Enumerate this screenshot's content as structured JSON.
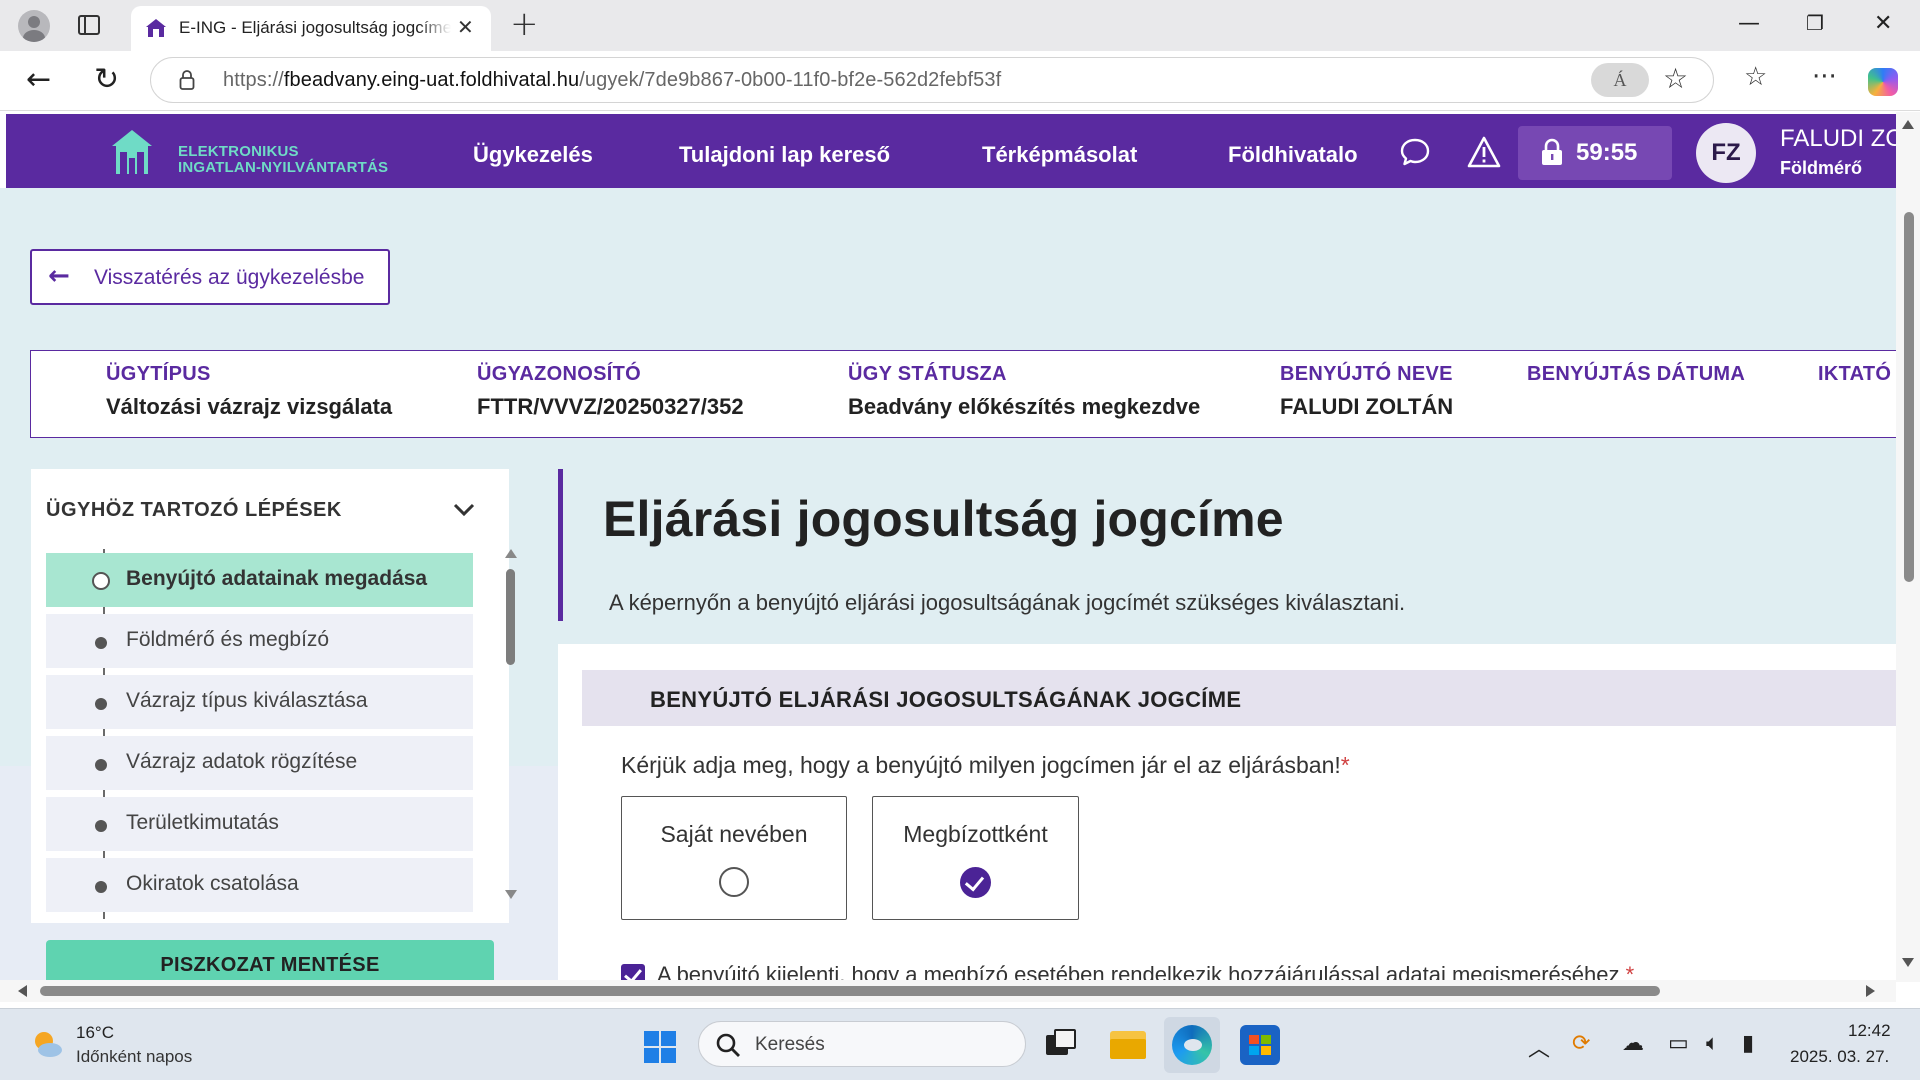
{
  "browser": {
    "tab_title": "E-ING - Eljárási jogosultság jogcíme",
    "url_prefix": "https://",
    "url_host": "fbeadvany.eing-uat.foldhivatal.hu",
    "url_path": "/ugyek/7de9b867-0b00-11f0-bf2e-562d2febf53f",
    "read_aloud": "Á"
  },
  "header": {
    "logo_line1": "ELEKTRONIKUS",
    "logo_line2": "INGATLAN-NYILVÁNTARTÁS",
    "nav": [
      "Ügykezelés",
      "Tulajdoni lap kereső",
      "Térképmásolat",
      "Földhivatalo"
    ],
    "timer": "59:55",
    "avatar_initials": "FZ",
    "user_name": "FALUDI ZO",
    "user_role": "Földmérő"
  },
  "back_button": {
    "label": "Visszatérés az ügykezelésbe"
  },
  "case": {
    "type_label": "ÜGYTÍPUS",
    "type_value": "Változási vázrajz vizsgálata",
    "id_label": "ÜGYAZONOSÍTÓ",
    "id_value": "FTTR/VVVZ/20250327/352",
    "status_label": "ÜGY STÁTUSZA",
    "status_value": "Beadvány előkészítés megkezdve",
    "submitter_label": "BENYÚJTÓ NEVE",
    "submitter_value": "FALUDI ZOLTÁN",
    "date_label": "BENYÚJTÁS DÁTUMA",
    "iktato_label": "IKTATÓ"
  },
  "steps": {
    "title": "ÜGYHÖZ TARTOZÓ LÉPÉSEK",
    "items": [
      {
        "label": "Benyújtó adatainak megadása",
        "active": true
      },
      {
        "label": "Földmérő és megbízó",
        "active": false
      },
      {
        "label": "Vázrajz típus kiválasztása",
        "active": false
      },
      {
        "label": "Vázrajz adatok rögzítése",
        "active": false
      },
      {
        "label": "Területkimutatás",
        "active": false
      },
      {
        "label": "Okiratok csatolása",
        "active": false
      }
    ],
    "draft_button": "PISZKOZAT MENTÉSE"
  },
  "main": {
    "title": "Eljárási jogosultság jogcíme",
    "description": "A képernyőn a benyújtó eljárási jogosultságának jogcímét szükséges kiválasztani.",
    "section_title": "BENYÚJTÓ ELJÁRÁSI JOGOSULTSÁGÁNAK JOGCÍME",
    "question": "Kérjük adja meg, hogy a benyújtó milyen jogcímen jár el az eljárásban!",
    "required_mark": "*",
    "options": [
      {
        "label": "Saját nevében",
        "selected": false
      },
      {
        "label": "Megbízottként",
        "selected": true
      }
    ],
    "consent_text": "A benyújtó kijelenti, hogy a megbízó esetében rendelkezik hozzájárulással adatai megismeréséhez",
    "consent_checked": true
  },
  "taskbar": {
    "weather_temp": "16°C",
    "weather_desc": "Időnként napos",
    "search_placeholder": "Keresés",
    "time": "12:42",
    "date": "2025. 03. 27."
  },
  "colors": {
    "brand_purple": "#5a2aa0",
    "brand_teal": "#6fdbc6",
    "active_step": "#a8e6d1",
    "draft_button": "#5fd3b0",
    "page_background": "#e0eef2"
  }
}
